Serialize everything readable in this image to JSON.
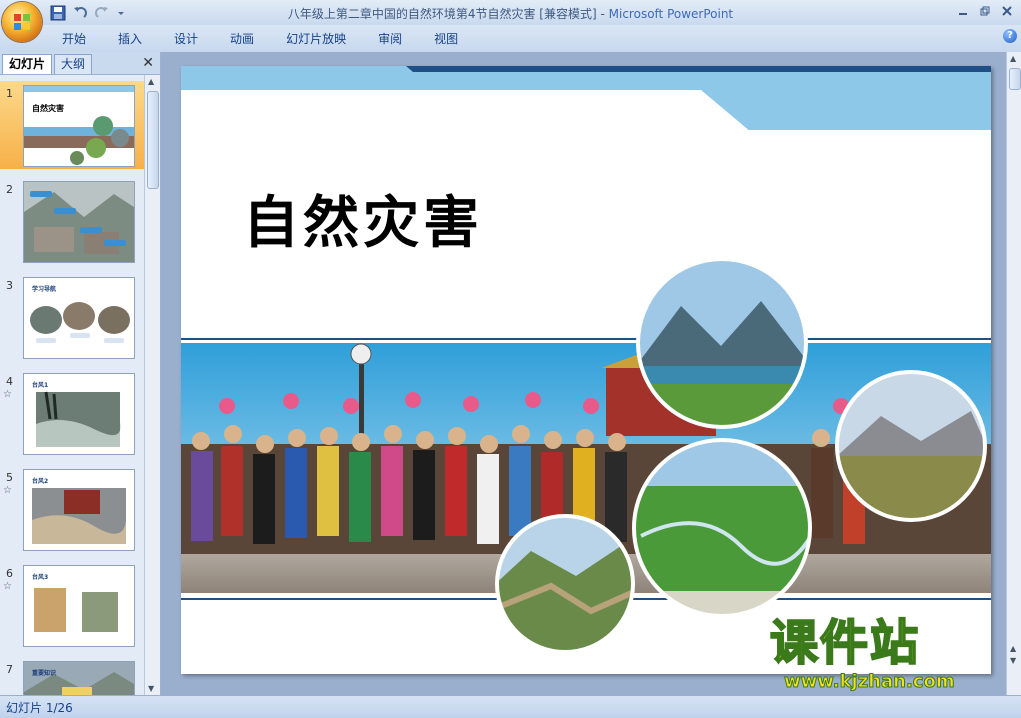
{
  "window": {
    "title_doc": "八年级上第二章中国的自然环境第4节自然灾害 [兼容模式]",
    "title_sep": " - ",
    "title_app": "Microsoft PowerPoint"
  },
  "ribbon": {
    "tabs": [
      "开始",
      "插入",
      "设计",
      "动画",
      "幻灯片放映",
      "审阅",
      "视图"
    ]
  },
  "pane": {
    "tab_slides": "幻灯片",
    "tab_outline": "大纲",
    "thumbnails": [
      {
        "num": "1",
        "star": "",
        "title": "自然灾害",
        "selected": true
      },
      {
        "num": "2",
        "star": "",
        "title": "",
        "selected": false
      },
      {
        "num": "3",
        "star": "",
        "title": "学习导航",
        "selected": false
      },
      {
        "num": "4",
        "star": "☆",
        "title": "台风1",
        "selected": false
      },
      {
        "num": "5",
        "star": "☆",
        "title": "台风2",
        "selected": false
      },
      {
        "num": "6",
        "star": "☆",
        "title": "台风3",
        "selected": false
      },
      {
        "num": "7",
        "star": "",
        "title": "重要知识",
        "selected": false
      }
    ]
  },
  "slide": {
    "title": "自然灾害"
  },
  "status": {
    "slide_indicator": "幻灯片 1/26"
  },
  "watermark": {
    "text_cn": "课件站",
    "url": "www.kjzhan.com"
  },
  "colors": {
    "ribbon": "#c7d8ee",
    "slide_band": "#8ec8e8",
    "navy_bar": "#1e4f86",
    "selection": "#f7b048",
    "watermark_fill": "#f3e11a"
  }
}
